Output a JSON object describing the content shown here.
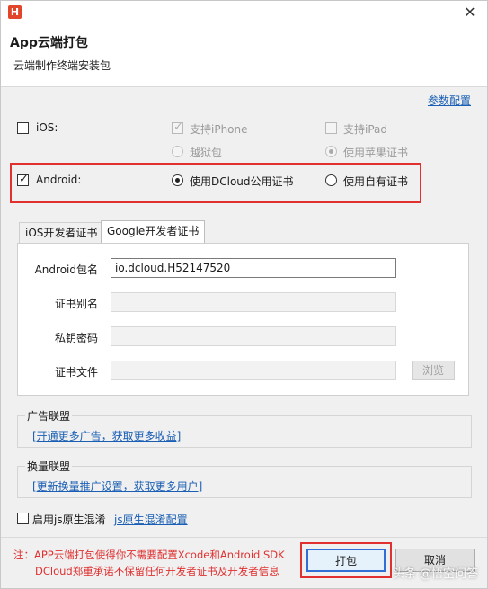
{
  "window": {
    "app_icon": "H",
    "close": "✕",
    "title": "App云端打包",
    "subtitle": "云端制作终端安装包"
  },
  "params_link": "参数配置",
  "ios": {
    "label": "iOS:",
    "checked": false,
    "support_iphone": "支持iPhone",
    "support_ipad": "支持iPad",
    "jailbreak": "越狱包",
    "apple_cert": "使用苹果证书"
  },
  "android": {
    "label": "Android:",
    "checked": true,
    "dcloud_cert": "使用DCloud公用证书",
    "own_cert": "使用自有证书",
    "selected": "dcloud_cert"
  },
  "tabs": [
    {
      "label": "iOS开发者证书",
      "active": false
    },
    {
      "label": "Google开发者证书",
      "active": true
    }
  ],
  "form": {
    "package_label": "Android包名",
    "package_value": "io.dcloud.H52147520",
    "alias_label": "证书别名",
    "alias_value": "",
    "password_label": "私钥密码",
    "password_value": "",
    "file_label": "证书文件",
    "file_value": "",
    "browse_label": "浏览"
  },
  "ad_union": {
    "title": "广告联盟",
    "link": "[开通更多广告，获取更多收益]"
  },
  "swap_union": {
    "title": "换量联盟",
    "link": "[更新换量推广设置，获取更多用户]"
  },
  "js_obfuscate": {
    "label": "启用js原生混淆",
    "checked": false,
    "config_link": "js原生混淆配置"
  },
  "footer": {
    "note_line1": "注：APP云端打包使得你不需要配置Xcode和Android SDK",
    "note_line2": "DCloud郑重承诺不保留任何开发者证书及开发者信息",
    "pack_button": "打包",
    "cancel_button": "取消"
  },
  "watermark": "头条 @悟空问答",
  "colors": {
    "highlight_red": "#e03030",
    "link_blue": "#1a5fb4",
    "primary_border": "#2f6fd6"
  }
}
